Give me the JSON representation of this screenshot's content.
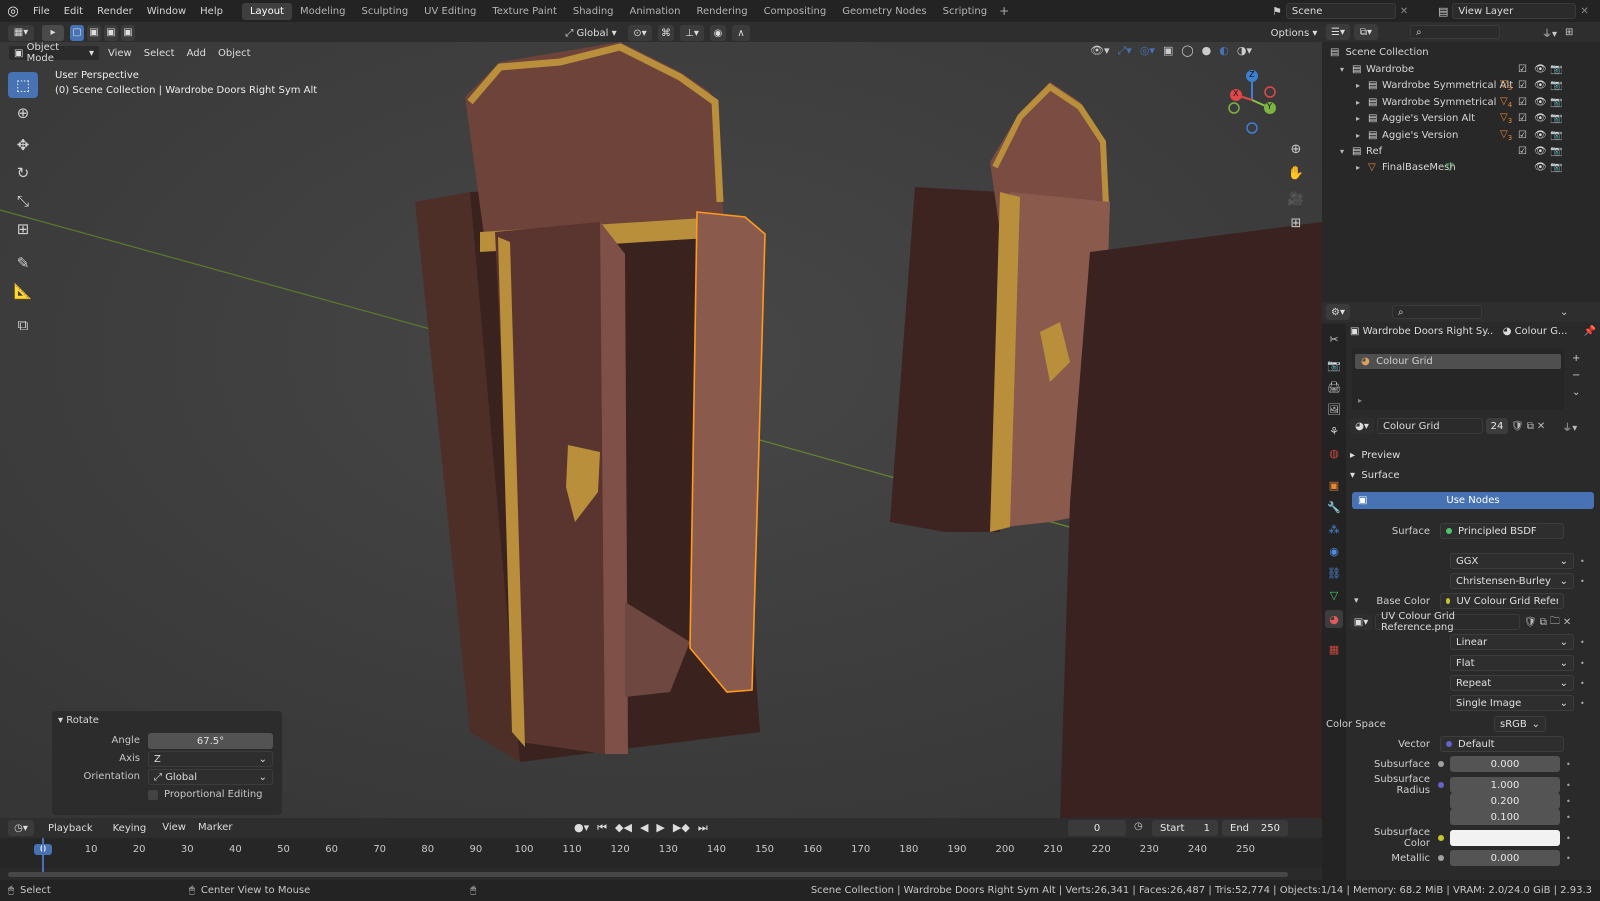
{
  "app": {
    "menus": [
      "File",
      "Edit",
      "Render",
      "Window",
      "Help"
    ],
    "workspaces": [
      "Layout",
      "Modeling",
      "Sculpting",
      "UV Editing",
      "Texture Paint",
      "Shading",
      "Animation",
      "Rendering",
      "Compositing",
      "Geometry Nodes",
      "Scripting"
    ],
    "active_workspace": "Layout",
    "scene": "Scene",
    "view_layer": "View Layer"
  },
  "header": {
    "mode": "Object Mode",
    "menus": [
      "View",
      "Select",
      "Add",
      "Object"
    ],
    "transform_orientation": "Global",
    "options": "Options"
  },
  "viewport": {
    "perspective": "User Perspective",
    "context": "(0) Scene Collection | Wardrobe Doors Right Sym Alt",
    "gizmo": {
      "x": "X",
      "y": "Y",
      "z": "Z"
    }
  },
  "redo": {
    "title": "Rotate",
    "angle_label": "Angle",
    "angle_value": "67.5°",
    "axis_label": "Axis",
    "axis_value": "Z",
    "orientation_label": "Orientation",
    "orientation_value": "Global",
    "proportional": "Proportional Editing"
  },
  "outliner": {
    "root": "Scene Collection",
    "items": [
      {
        "name": "Wardrobe",
        "type": "collection",
        "indent": 0
      },
      {
        "name": "Wardrobe Symmetrical Alt",
        "type": "collection",
        "indent": 1,
        "badge": "3"
      },
      {
        "name": "Wardrobe Symmetrical",
        "type": "collection",
        "indent": 1,
        "badge": "4"
      },
      {
        "name": "Aggie's Version Alt",
        "type": "collection",
        "indent": 1,
        "badge": "3"
      },
      {
        "name": "Aggie's Version",
        "type": "collection",
        "indent": 1,
        "badge": "3"
      },
      {
        "name": "Ref",
        "type": "collection",
        "indent": 0
      },
      {
        "name": "FinalBaseMesh",
        "type": "mesh",
        "indent": 1
      }
    ]
  },
  "properties": {
    "object_name": "Wardrobe Doors Right Sy...",
    "material_short": "Colour G...",
    "slot": "Colour Grid",
    "material": "Colour Grid",
    "users": "24",
    "sections": {
      "preview": "Preview",
      "surface": "Surface"
    },
    "use_nodes": "Use Nodes",
    "rows": [
      {
        "label": "Surface",
        "value": "Principled BSDF",
        "kind": "link",
        "dot": "#4fc36b"
      },
      {
        "label": "",
        "value": "GGX",
        "kind": "dropdown"
      },
      {
        "label": "",
        "value": "Christensen-Burley",
        "kind": "dropdown"
      },
      {
        "label": "Base Color",
        "value": "UV Colour Grid Reference...",
        "kind": "link",
        "dot": "#c7c729"
      },
      {
        "label": "",
        "value": "UV Colour Grid Reference.png",
        "kind": "image"
      },
      {
        "label": "",
        "value": "Linear",
        "kind": "dropdown"
      },
      {
        "label": "",
        "value": "Flat",
        "kind": "dropdown"
      },
      {
        "label": "",
        "value": "Repeat",
        "kind": "dropdown"
      },
      {
        "label": "",
        "value": "Single Image",
        "kind": "dropdown"
      },
      {
        "label": "Color Space",
        "value": "sRGB",
        "kind": "colorspace"
      },
      {
        "label": "Vector",
        "value": "Default",
        "kind": "link",
        "dot": "#6363c7"
      },
      {
        "label": "Subsurface",
        "value": "0.000",
        "kind": "number",
        "dot": "#a1a1a1"
      },
      {
        "label": "Subsurface Radius",
        "value": "1.000",
        "kind": "number",
        "dot": "#6363c7"
      },
      {
        "label": "",
        "value": "0.200",
        "kind": "number"
      },
      {
        "label": "",
        "value": "0.100",
        "kind": "number"
      },
      {
        "label": "Subsurface Color",
        "value": "",
        "kind": "color",
        "dot": "#c7c729"
      },
      {
        "label": "Metallic",
        "value": "0.000",
        "kind": "number",
        "dot": "#a1a1a1"
      }
    ]
  },
  "timeline": {
    "menus": [
      "Playback",
      "Keying",
      "View",
      "Marker"
    ],
    "current_frame": "0",
    "start_label": "Start",
    "start": "1",
    "end_label": "End",
    "end": "250",
    "ticks": [
      "0",
      "10",
      "20",
      "30",
      "40",
      "50",
      "60",
      "70",
      "80",
      "90",
      "100",
      "110",
      "120",
      "130",
      "140",
      "150",
      "160",
      "170",
      "180",
      "190",
      "200",
      "210",
      "220",
      "230",
      "240",
      "250"
    ]
  },
  "status": {
    "left": "Select",
    "middle": "Center View to Mouse",
    "right": "Scene Collection | Wardrobe Doors Right Sym Alt | Verts:26,341 | Faces:26,487 | Tris:52,774 | Objects:1/14 | Memory: 68.2 MiB | VRAM: 2.0/24.0 GiB | 2.93.3"
  },
  "colors": {
    "accent": "#4772b3",
    "selection": "#ff9a1f",
    "wood_light": "#8a5a4d",
    "wood_dark": "#3c2420",
    "gold": "#b98f3c"
  }
}
